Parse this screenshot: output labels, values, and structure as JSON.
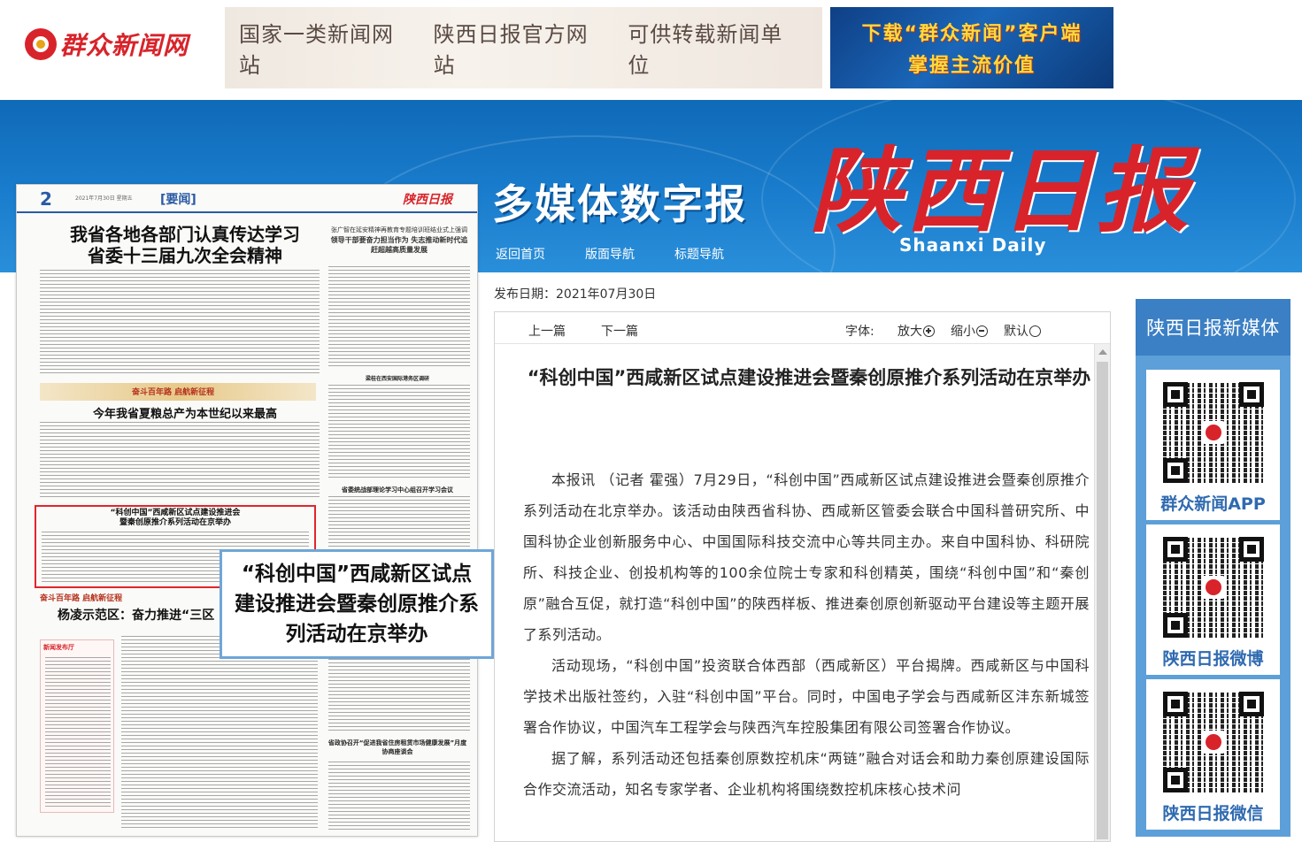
{
  "site": {
    "logo_text": "群众新闻网",
    "banner_slogans": [
      "国家一类新闻网站",
      "陕西日报官方网站",
      "可供转载新闻单位"
    ],
    "promo_line1": "下载“群众新闻”客户端",
    "promo_line2": "掌握主流价值"
  },
  "masthead": {
    "subtitle": "多媒体数字报",
    "paper_name": "陕西日报",
    "paper_name_en": "Shaanxi Daily",
    "nav": [
      "返回首页",
      "版面导航",
      "标题导航"
    ]
  },
  "page_image": {
    "page_no": "2",
    "date_line": "2021年7月30日 星期五",
    "section": "[要闻]",
    "logo": "陕西日报",
    "headline_1a": "我省各地各部门认真传达学习",
    "headline_1b": "省委十三届九次全会精神",
    "side_head_small": "张广智在延安精神再教育专题培训班结业式上强调",
    "side_head_bold": "领导干部要奋力担当作为 失志推动新时代追赶超越高质量发展",
    "banner_text": "奋斗百年路 启航新征程",
    "headline_2": "今年我省夏粮总产为本世纪以来最高",
    "mid_head_1": "梁桂在西安国际港务区调研",
    "mid_head_2": "省委统战部理论学习中心组召开学习会议",
    "highlight_line1": "“科创中国”西咸新区试点建设推进会",
    "highlight_line2": "暨秦创原推介系列活动在京举办",
    "section_bar_3": "奋斗百年路 启航新征程",
    "headline_3": "杨凌示范区：奋力推进“三区",
    "box_title": "新闻发布厅",
    "mid_head_3": "省政协召开“促进我省住房租赁市场健康发展”月度协商座谈会"
  },
  "popup": {
    "text": "“科创中国”西咸新区试点建设推进会暨秦创原推介系列活动在京举办"
  },
  "article": {
    "publish_date": "发布日期：2021年07月30日",
    "prev": "上一篇",
    "next": "下一篇",
    "font_label": "字体:",
    "zoom_in": "放大",
    "zoom_out": "缩小",
    "zoom_default": "默认",
    "title": "“科创中国”西咸新区试点建设推进会暨秦创原推介系列活动在京举办",
    "paragraphs": [
      "本报讯 （记者 霍强）7月29日，“科创中国”西咸新区试点建设推进会暨秦创原推介系列活动在北京举办。该活动由陕西省科协、西咸新区管委会联合中国科普研究所、中国科协企业创新服务中心、中国国际科技交流中心等共同主办。来自中国科协、科研院所、科技企业、创投机构等的100余位院士专家和科创精英，围绕“科创中国”和“秦创原”融合互促，就打造“科创中国”的陕西样板、推进秦创原创新驱动平台建设等主题开展了系列活动。",
      "活动现场，“科创中国”投资联合体西部（西咸新区）平台揭牌。西咸新区与中国科学技术出版社签约，入驻“科创中国”平台。同时，中国电子学会与西咸新区沣东新城签署合作协议，中国汽车工程学会与陕西汽车控股集团有限公司签署合作协议。",
      "据了解，系列活动还包括秦创原数控机床“两链”融合对话会和助力秦创原建设国际合作交流活动，知名专家学者、企业机构将围绕数控机床核心技术问"
    ]
  },
  "sidebar": {
    "title": "陕西日报新媒体",
    "qr_labels": [
      "群众新闻APP",
      "陕西日报微博",
      "陕西日报微信"
    ]
  }
}
